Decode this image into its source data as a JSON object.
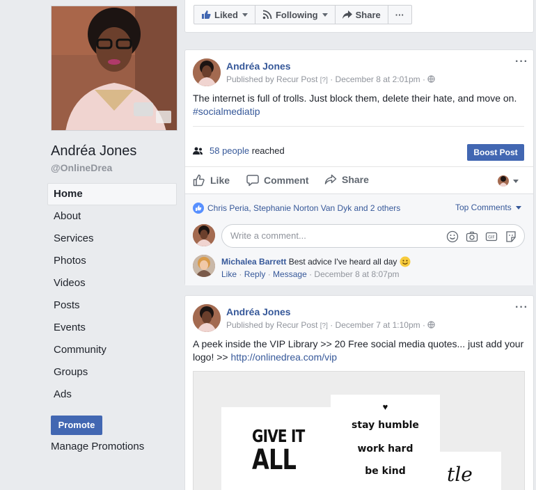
{
  "page": {
    "name": "Andréa Jones",
    "handle": "@OnlineDrea"
  },
  "nav": {
    "items": [
      "Home",
      "About",
      "Services",
      "Photos",
      "Videos",
      "Posts",
      "Events",
      "Community",
      "Groups",
      "Ads"
    ],
    "active": "Home"
  },
  "promote": {
    "button_label": "Promote",
    "manage_label": "Manage Promotions"
  },
  "top_bar": {
    "liked_label": "Liked",
    "following_label": "Following",
    "share_label": "Share",
    "more_label": "···"
  },
  "post1": {
    "author": "Andréa Jones",
    "published_by": "Published by Recur Post",
    "q_mark": "[?]",
    "timestamp": "December 8 at 2:01pm",
    "text_before_link": "The internet is full of trolls. Just block them, delete their hate, and move on. ",
    "hashtag": "#socialmediatip",
    "reach_count": "58 people",
    "reach_suffix": "reached",
    "boost_label": "Boost Post",
    "actions": {
      "like": "Like",
      "comment": "Comment",
      "share": "Share"
    },
    "reactions_text": "Chris Peria, Stephanie Norton Van Dyk and 2 others",
    "top_comments_label": "Top Comments",
    "comment_placeholder": "Write a comment...",
    "comment": {
      "author": "Michalea Barrett",
      "text": "Best advice I've heard all day",
      "like": "Like",
      "reply": "Reply",
      "message": "Message",
      "time": "December 8 at 8:07pm"
    }
  },
  "post2": {
    "author": "Andréa Jones",
    "published_by": "Published by Recur Post",
    "q_mark": "[?]",
    "timestamp": "December 7 at 1:10pm",
    "text": "A peek inside the VIP Library >> 20 Free social media quotes... just add your logo! >> ",
    "link": "http://onlinedrea.com/vip",
    "image_quotes": {
      "left": "GIVE IT ALL",
      "heart": "♥",
      "line1": "stay humble",
      "line2": "work hard",
      "line3": "be kind",
      "right_partial": "tle"
    }
  },
  "colors": {
    "brand": "#4267b2",
    "link": "#365899",
    "background": "#e9ebee"
  }
}
